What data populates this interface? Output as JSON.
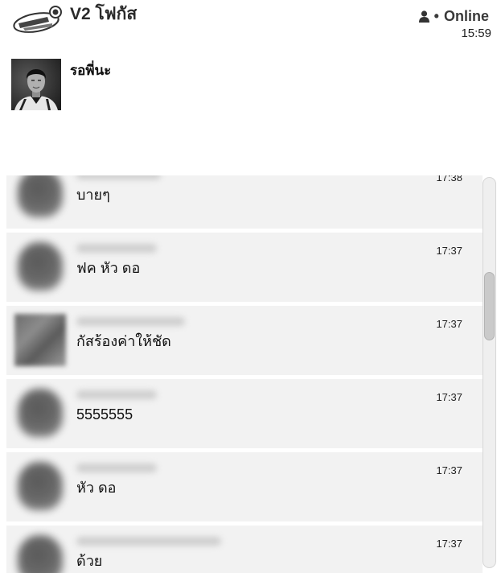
{
  "header": {
    "logo_icon": "app-logo",
    "title": "V2 โฟกัส",
    "status_icon": "person-icon",
    "status_dot": "•",
    "status_text": "Online",
    "time": "15:59"
  },
  "profile": {
    "name": "รอพี่นะ"
  },
  "feed": {
    "messages": [
      {
        "time": "17:38",
        "text": "บายๆ"
      },
      {
        "time": "17:37",
        "text": "ฟค หัว ดอ"
      },
      {
        "time": "17:37",
        "text": "กัสร้องค่าให้ชัด"
      },
      {
        "time": "17:37",
        "text": "5555555"
      },
      {
        "time": "17:37",
        "text": "หัว ดอ"
      },
      {
        "time": "17:37",
        "text": "ด้วย"
      }
    ],
    "scroll_progress": 0.29
  },
  "colors": {
    "background": "#ffffff",
    "card_background": "#f2f2f2",
    "text": "#1a1a1a",
    "status_text": "#3a3a3a"
  }
}
